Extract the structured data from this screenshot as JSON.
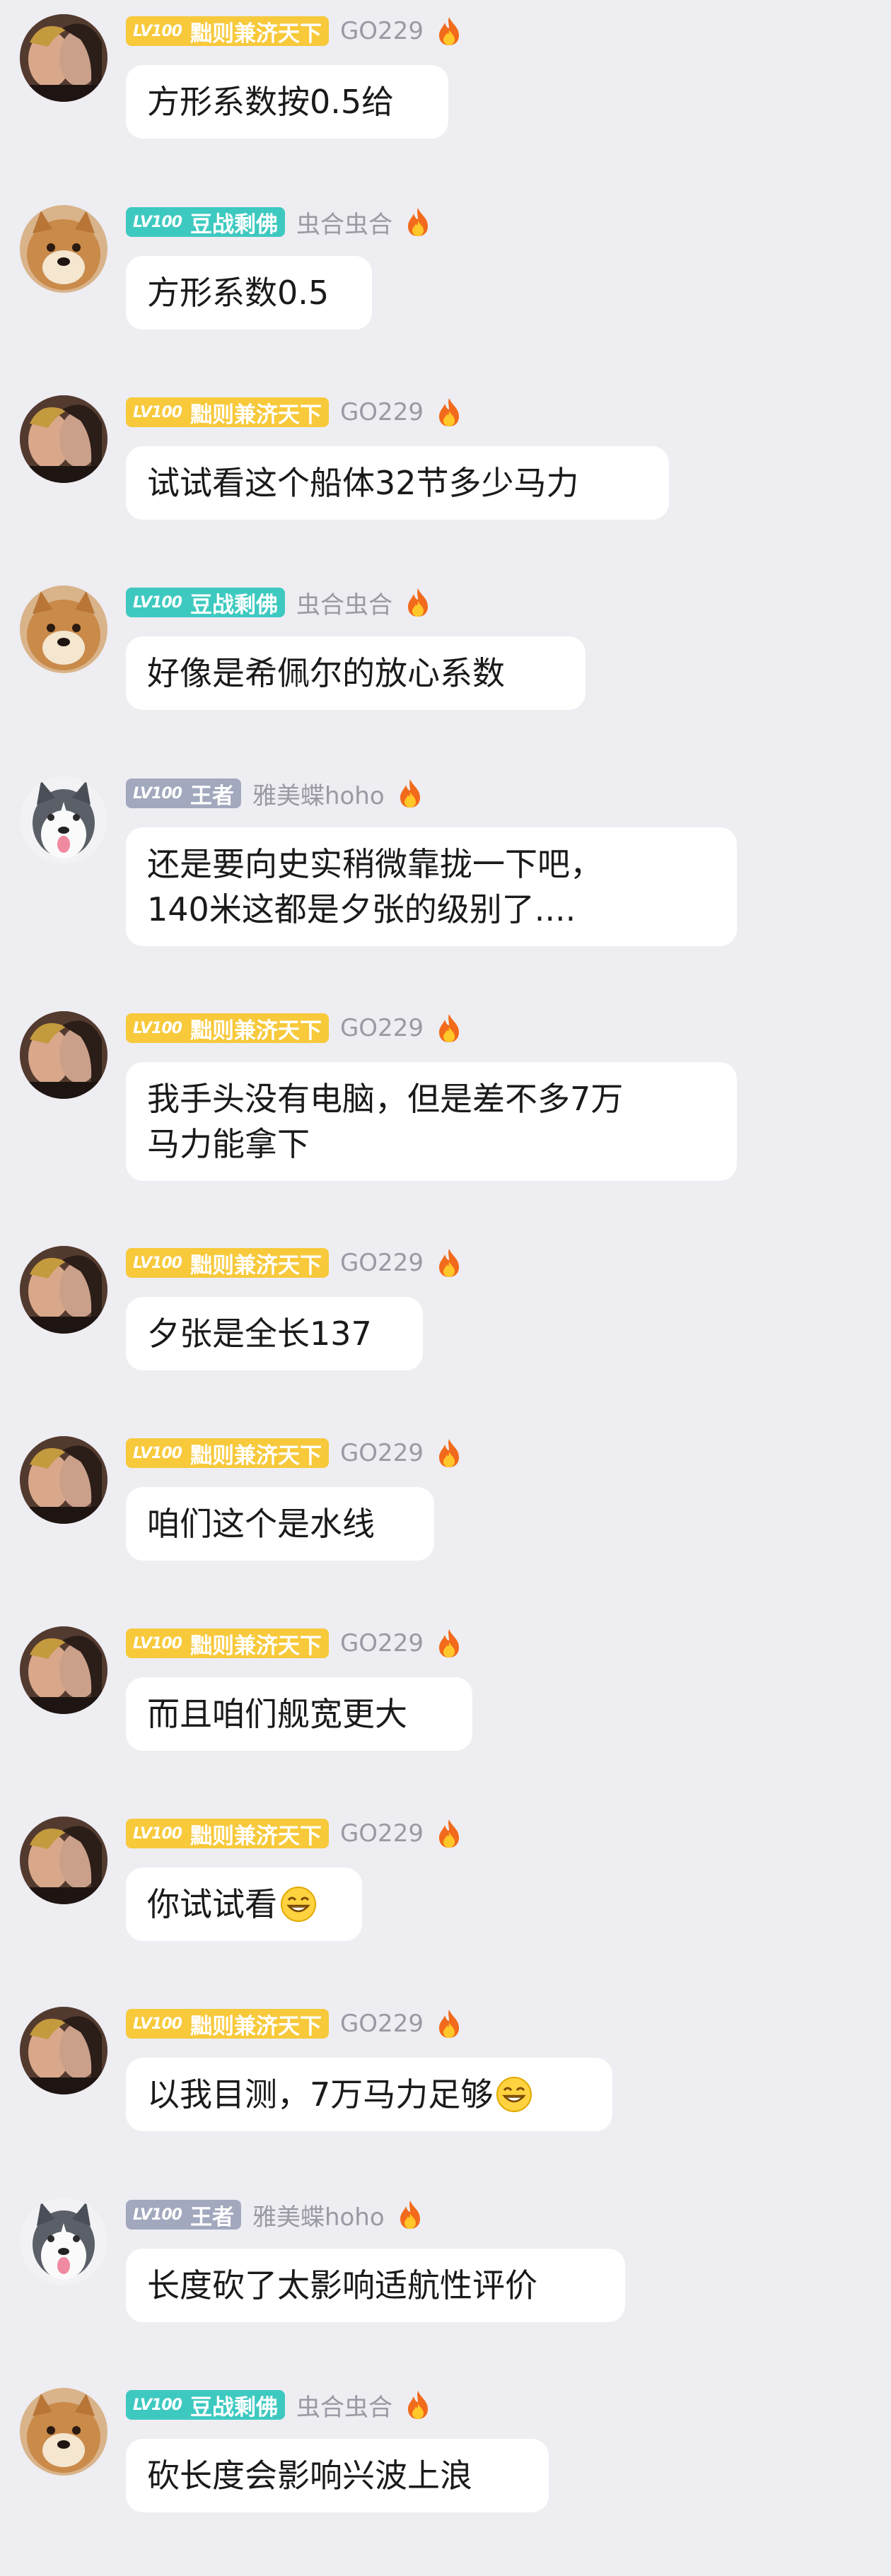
{
  "colors": {
    "background": "#ededf2",
    "bubble": "#ffffff",
    "badge_yellow": "#f7c93b",
    "badge_teal": "#3ec9c0",
    "badge_gray": "#a2a8bd",
    "username": "#9a9aa4"
  },
  "messages": [
    {
      "badge_level": "LV100",
      "badge_title": "黜则兼济天下",
      "badge_color": "yellow",
      "username": "GO229",
      "avatar": "couple-avatar",
      "lines": [
        "方形系数按0.5给"
      ]
    },
    {
      "badge_level": "LV100",
      "badge_title": "豆战剩佛",
      "badge_color": "teal",
      "username": "虫合虫合",
      "avatar": "shiba-avatar",
      "lines": [
        "方形系数0.5"
      ]
    },
    {
      "badge_level": "LV100",
      "badge_title": "黜则兼济天下",
      "badge_color": "yellow",
      "username": "GO229",
      "avatar": "couple-avatar",
      "lines": [
        "试试看这个船体32节多少马力"
      ]
    },
    {
      "badge_level": "LV100",
      "badge_title": "豆战剩佛",
      "badge_color": "teal",
      "username": "虫合虫合",
      "avatar": "shiba-avatar",
      "lines": [
        "好像是希佩尔的放心系数"
      ]
    },
    {
      "badge_level": "LV100",
      "badge_title": "王者",
      "badge_color": "gray",
      "username": "雅美蝶hoho",
      "avatar": "husky-avatar",
      "lines": [
        "还是要向史实稍微靠拢一下吧，",
        "140米这都是夕张的级别了...."
      ]
    },
    {
      "badge_level": "LV100",
      "badge_title": "黜则兼济天下",
      "badge_color": "yellow",
      "username": "GO229",
      "avatar": "couple-avatar",
      "lines": [
        "我手头没有电脑，但是差不多7万",
        "马力能拿下"
      ]
    },
    {
      "badge_level": "LV100",
      "badge_title": "黜则兼济天下",
      "badge_color": "yellow",
      "username": "GO229",
      "avatar": "couple-avatar",
      "lines": [
        "夕张是全长137"
      ]
    },
    {
      "badge_level": "LV100",
      "badge_title": "黜则兼济天下",
      "badge_color": "yellow",
      "username": "GO229",
      "avatar": "couple-avatar",
      "lines": [
        "咱们这个是水线"
      ]
    },
    {
      "badge_level": "LV100",
      "badge_title": "黜则兼济天下",
      "badge_color": "yellow",
      "username": "GO229",
      "avatar": "couple-avatar",
      "lines": [
        "而且咱们舰宽更大"
      ]
    },
    {
      "badge_level": "LV100",
      "badge_title": "黜则兼济天下",
      "badge_color": "yellow",
      "username": "GO229",
      "avatar": "couple-avatar",
      "lines": [
        "你试试看"
      ],
      "emoji": "grin-emoji"
    },
    {
      "badge_level": "LV100",
      "badge_title": "黜则兼济天下",
      "badge_color": "yellow",
      "username": "GO229",
      "avatar": "couple-avatar",
      "lines": [
        "以我目测，7万马力足够"
      ],
      "emoji": "grin-emoji"
    },
    {
      "badge_level": "LV100",
      "badge_title": "王者",
      "badge_color": "gray",
      "username": "雅美蝶hoho",
      "avatar": "husky-avatar",
      "lines": [
        "长度砍了太影响适航性评价"
      ]
    },
    {
      "badge_level": "LV100",
      "badge_title": "豆战剩佛",
      "badge_color": "teal",
      "username": "虫合虫合",
      "avatar": "shiba-avatar",
      "lines": [
        "砍长度会影响兴波上浪"
      ]
    }
  ]
}
